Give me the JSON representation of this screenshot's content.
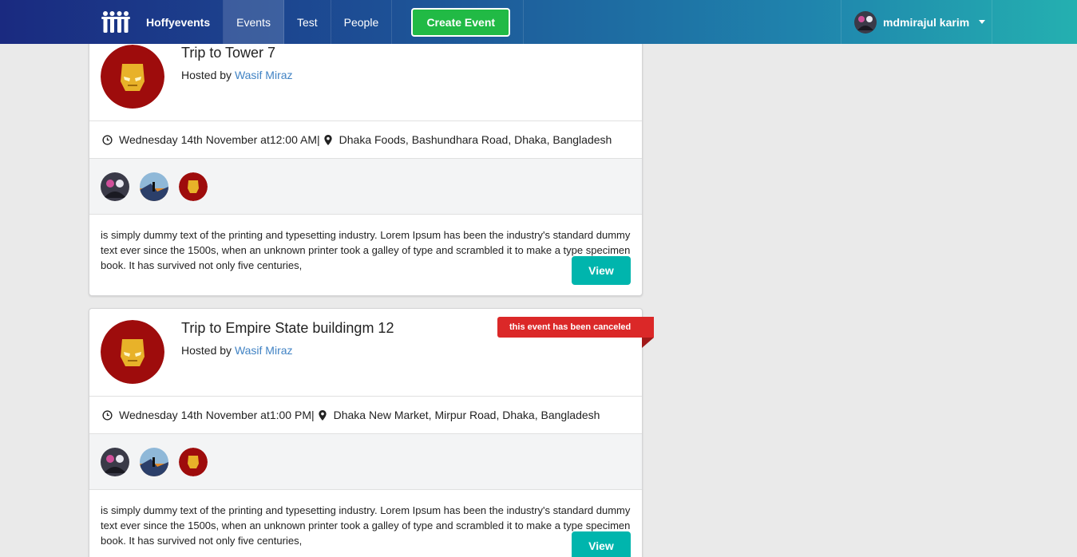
{
  "nav": {
    "brand": "Hoffyevents",
    "items": [
      "Events",
      "Test",
      "People"
    ],
    "create_button": "Create Event",
    "user_name": "mdmirajul karim"
  },
  "events": [
    {
      "title": "Trip to Tower 7",
      "hosted_prefix": "Hosted by ",
      "host": "Wasif Miraz",
      "date": "Wednesday 14th November at12:00 AM|",
      "venue": "Dhaka Foods, Bashundhara Road, Dhaka, Bangladesh",
      "description": "is simply dummy text of the printing and typesetting industry. Lorem Ipsum has been the industry's standard dummy text ever since the 1500s, when an unknown printer took a galley of type and scrambled it to make a type specimen book. It has survived not only five centuries,",
      "view_label": "View"
    },
    {
      "title": "Trip to Empire State buildingm 12",
      "hosted_prefix": "Hosted by ",
      "host": "Wasif Miraz",
      "date": "Wednesday 14th November at1:00 PM|",
      "venue": "Dhaka New Market, Mirpur Road, Dhaka, Bangladesh",
      "description": "is simply dummy text of the printing and typesetting industry. Lorem Ipsum has been the industry's standard dummy text ever since the 1500s, when an unknown printer took a galley of type and scrambled it to make a type specimen book. It has survived not only five centuries,",
      "view_label": "View",
      "cancel_label": "this event has been canceled"
    }
  ],
  "colors": {
    "create_button": "#21ba45",
    "view_button": "#00b5ad",
    "cancel_ribbon": "#db2828",
    "link": "#4183c4"
  },
  "icons": [
    "people-logo-icon",
    "clock-icon",
    "map-marker-icon",
    "caret-down-icon",
    "iron-man-avatar"
  ]
}
